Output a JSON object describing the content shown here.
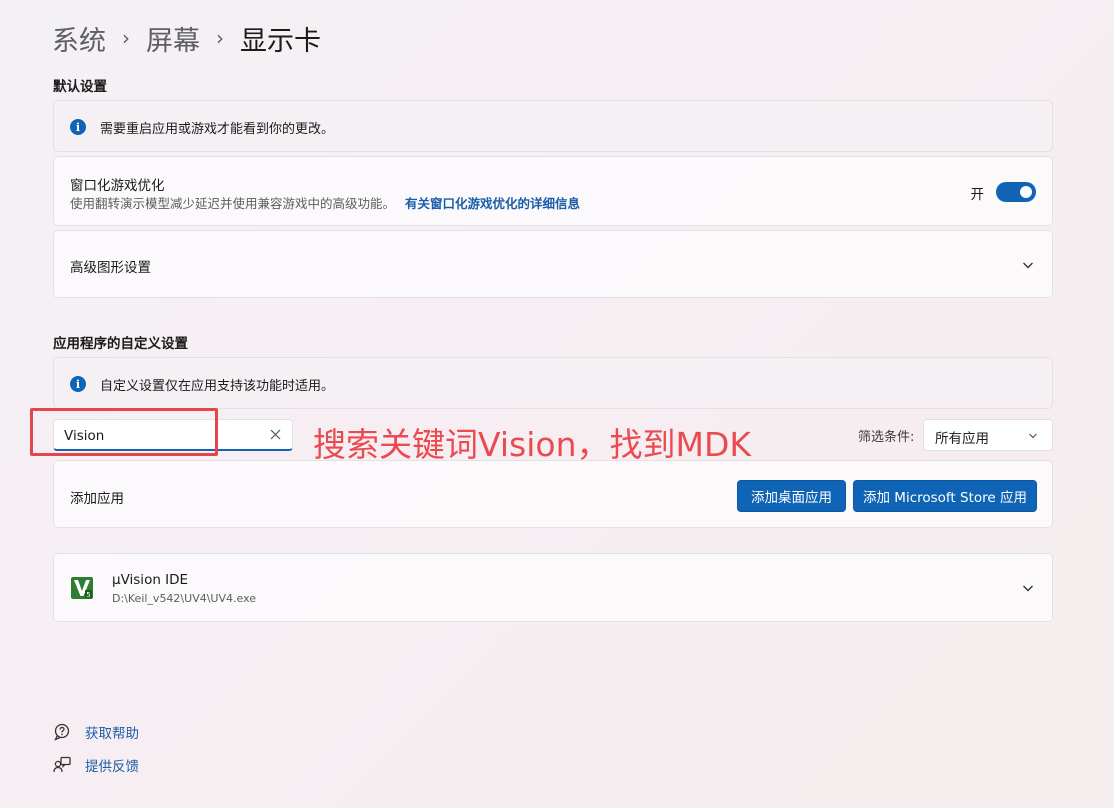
{
  "breadcrumb": {
    "items": [
      "系统",
      "屏幕"
    ],
    "separator": "›",
    "current": "显示卡"
  },
  "default_settings": {
    "title": "默认设置",
    "info": "需要重启应用或游戏才能看到你的更改。",
    "windowed_opt": {
      "title": "窗口化游戏优化",
      "description": "使用翻转演示模型减少延迟并使用兼容游戏中的高级功能。",
      "link": "有关窗口化游戏优化的详细信息",
      "toggle_label": "开",
      "toggle_on": true
    },
    "advanced": {
      "title": "高级图形设置"
    }
  },
  "custom_settings": {
    "title": "应用程序的自定义设置",
    "info": "自定义设置仅在应用支持该功能时适用。",
    "search": {
      "value": "Vision",
      "placeholder": ""
    },
    "filter": {
      "label": "筛选条件:",
      "value": "所有应用"
    },
    "add_app": {
      "label": "添加应用",
      "desktop_button": "添加桌面应用",
      "store_button": "添加 Microsoft Store 应用"
    },
    "apps": [
      {
        "name": "µVision IDE",
        "path": "D:\\Keil_v542\\UV4\\UV4.exe",
        "icon": "uvision-app-icon"
      }
    ]
  },
  "annotation": {
    "text": "搜索关键词Vision，找到MDK",
    "color": "#ea4b50"
  },
  "footer": {
    "help": "获取帮助",
    "feedback": "提供反馈"
  },
  "colors": {
    "accent": "#0f64b6",
    "link": "#1a5ea8",
    "annotation": "#ea4b50"
  }
}
